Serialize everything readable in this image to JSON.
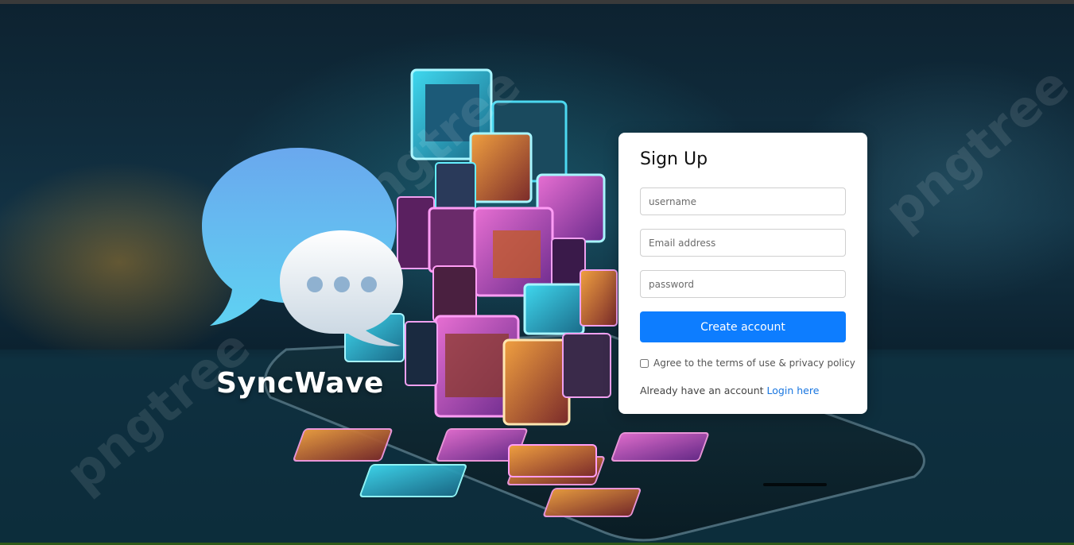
{
  "brand": {
    "name": "SyncWave"
  },
  "watermark": {
    "text": "pngtree"
  },
  "signup": {
    "title": "Sign Up",
    "username_placeholder": "username",
    "email_placeholder": "Email address",
    "password_placeholder": "password",
    "submit_label": "Create account",
    "agree_label": "Agree to the terms of use & privacy policy",
    "agree_checked": false,
    "login_prompt": "Already have an account",
    "login_link": "Login here"
  },
  "colors": {
    "accent": "#0d7dff",
    "link": "#1976e0",
    "card_bg": "#ffffff"
  },
  "icons": [
    "chat-bubbles-icon"
  ]
}
